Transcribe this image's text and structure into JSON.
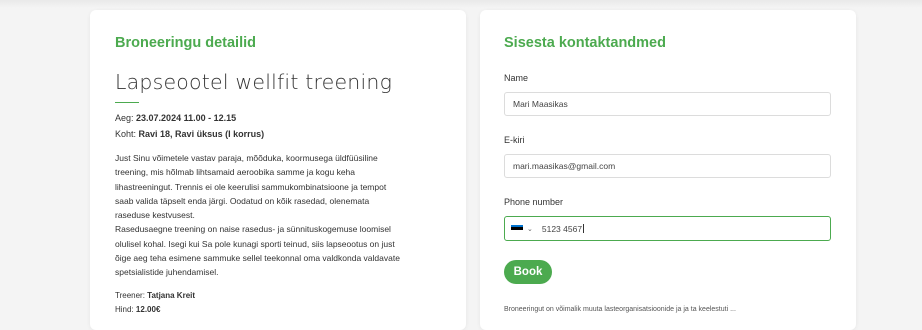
{
  "booking": {
    "section_title": "Broneeringu detailid",
    "event_title": "Lapseootel wellfit treening",
    "time_label": "Aeg:",
    "time_value": "23.07.2024 11.00 - 12.15",
    "place_label": "Koht:",
    "place_value": "Ravi 18, Ravi üksus (I korrus)",
    "description_lines": [
      "Just Sinu võimetele vastav paraja, mõõduka, koormusega üldfüüsiline",
      "treening, mis hõlmab lihtsamaid aeroobika samme ja kogu keha",
      "lihastreeningut. Trennis ei ole keerulisi sammukombinatsioone ja tempot",
      "saab valida täpselt enda järgi. Oodatud on kõik rasedad, olenemata",
      "raseduse kestvusest.",
      "Rasedusaegne treening on naise rasedus- ja sünnituskogemuse loomisel",
      "olulisel kohal. Isegi kui Sa pole kunagi sporti teinud, siis lapseootus on just",
      "õige aeg teha esimene sammuke sellel teekonnal oma valdkonda valdavate",
      "spetsialistide juhendamisel."
    ],
    "trainer_label": "Treener:",
    "trainer_value": "Tatjana Kreit",
    "price_label": "Hind:",
    "price_value": "12.00€"
  },
  "contact": {
    "section_title": "Sisesta kontaktandmed",
    "name_label": "Name",
    "name_value": "Mari Maasikas",
    "email_label": "E-kiri",
    "email_value": "mari.maasikas@gmail.com",
    "phone_label": "Phone number",
    "phone_value": "5123 4567",
    "flag_colors": [
      "#0072ce",
      "#000000",
      "#ffffff"
    ],
    "chevron_icon": "chevron-down-icon",
    "book_label": "Book",
    "footnote": "Broneeringut on võimalik muuta lasteorganisatsioonide ja ja ta keelestuti ..."
  },
  "colors": {
    "accent": "#4caa4f",
    "background": "#f4f4f4",
    "card": "#ffffff"
  }
}
